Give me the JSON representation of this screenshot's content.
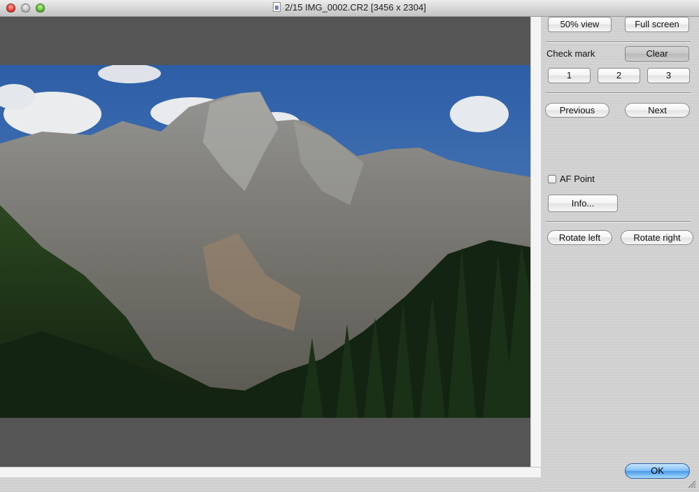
{
  "window": {
    "title": "2/15 IMG_0002.CR2 [3456 x 2304]"
  },
  "icons": {
    "close": "close-icon",
    "minimize": "minimize-icon",
    "zoom": "zoom-icon",
    "document": "document-icon",
    "resize": "resize-grip-icon"
  },
  "panel": {
    "view_button": "50%   view",
    "fullscreen_button": "Full screen",
    "check_mark_label": "Check mark",
    "clear_button": "Clear",
    "mark_buttons": [
      "1",
      "2",
      "3"
    ],
    "previous_button": "Previous",
    "next_button": "Next",
    "af_point": {
      "label": "AF Point",
      "checked": false
    },
    "info_button": "Info...",
    "rotate_left_button": "Rotate left",
    "rotate_right_button": "Rotate right",
    "ok_button": "OK"
  },
  "colors": {
    "ok_button": "#4a98e8",
    "viewer_background": "#555555",
    "sky": "#3f6fb4"
  }
}
